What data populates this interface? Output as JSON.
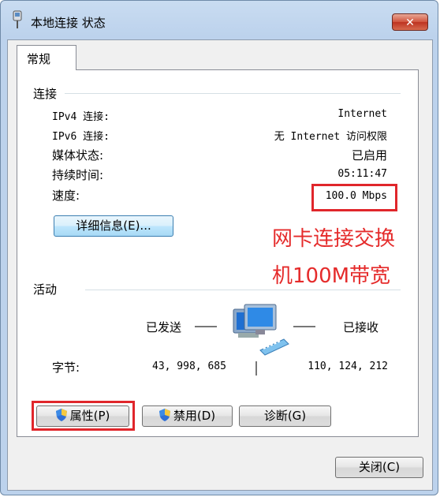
{
  "window": {
    "title": "本地连接 状态",
    "close_label": "✕"
  },
  "tabs": [
    {
      "label": "常规"
    }
  ],
  "connection": {
    "heading": "连接",
    "rows": [
      {
        "label": "IPv4 连接:",
        "value": "Internet"
      },
      {
        "label": "IPv6 连接:",
        "value": "无 Internet 访问权限"
      },
      {
        "label": "媒体状态:",
        "value": "已启用"
      },
      {
        "label": "持续时间:",
        "value": "05:11:47"
      },
      {
        "label": "速度:",
        "value": "100.0 Mbps"
      }
    ],
    "details_button": "详细信息(E)..."
  },
  "activity": {
    "heading": "活动",
    "sent_label": "已发送",
    "received_label": "已接收",
    "bytes_label": "字节:",
    "bytes_sent": "43, 998, 685",
    "bytes_received": "110, 124, 212"
  },
  "buttons": {
    "properties": "属性(P)",
    "disable": "禁用(D)",
    "diagnose": "诊断(G)",
    "close": "关闭(C)"
  },
  "annotation": {
    "line1": "网卡连接交换",
    "line2": "机100M带宽"
  },
  "colors": {
    "annotation": "#e52b2b",
    "panel_bg": "#ffffff",
    "frame": "#bcd2ec"
  },
  "icons": {
    "window": "network-adapter-icon",
    "activity": "network-computers-icon",
    "shield": "uac-shield-icon"
  }
}
